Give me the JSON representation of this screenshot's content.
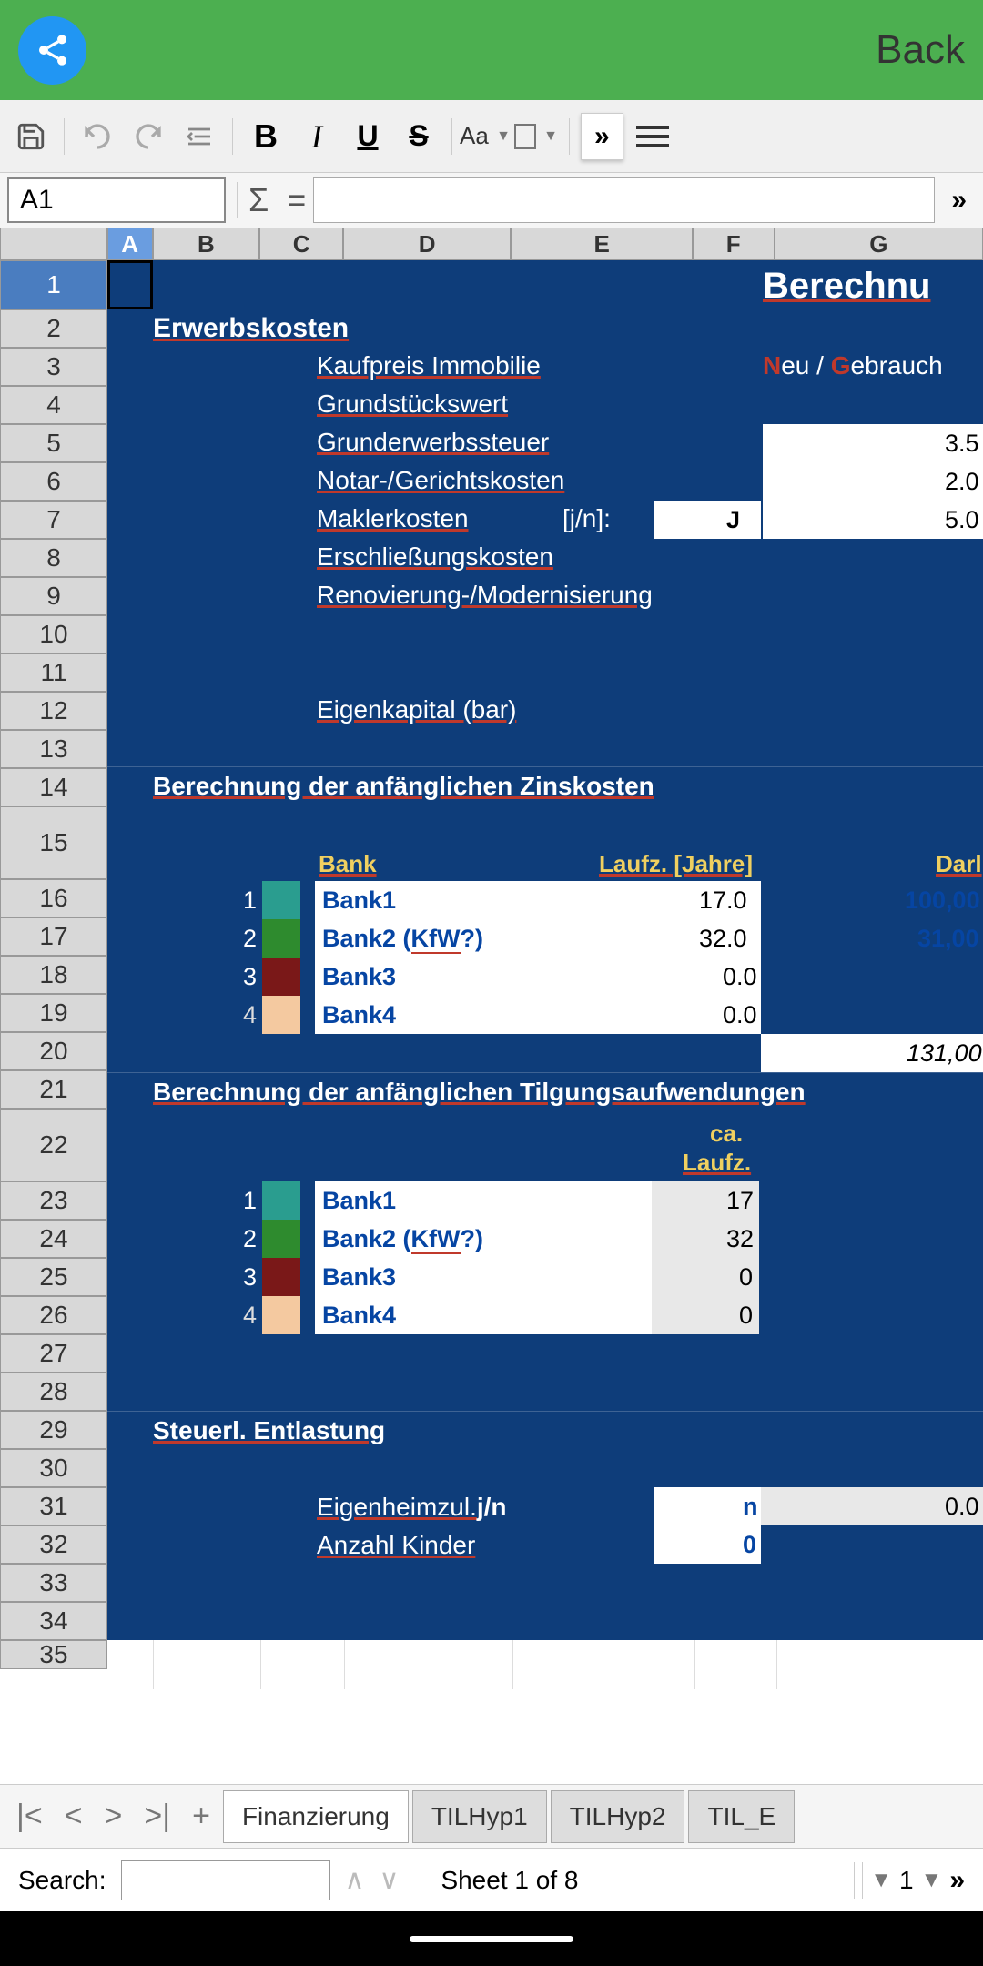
{
  "header": {
    "back": "Back"
  },
  "formula": {
    "cell_ref": "A1"
  },
  "columns": [
    "A",
    "B",
    "C",
    "D",
    "E",
    "F",
    "G"
  ],
  "rows": [
    1,
    2,
    3,
    4,
    5,
    6,
    7,
    8,
    9,
    10,
    11,
    12,
    13,
    14,
    15,
    16,
    17,
    18,
    19,
    20,
    21,
    22,
    23,
    24,
    25,
    26,
    27,
    28,
    29,
    30,
    31,
    32,
    33,
    34,
    35
  ],
  "content": {
    "title": "Berechnu",
    "sec_erwerb": "Erwerbskosten",
    "kaufpreis": "Kaufpreis Immobilie",
    "neu_gebraucht_n": "N",
    "neu_gebraucht_mid": "eu / ",
    "neu_gebraucht_g": "G",
    "neu_gebraucht_end": "ebrauch",
    "grundst": "Grundstückswert",
    "grunderwerb": "Grunderwerbssteuer",
    "v3_50": "3.5",
    "notar": "Notar-/Gerichtskosten",
    "v2_00": "2.0",
    "makler": "Maklerkosten",
    "jn": "[j/n]:",
    "j": "J",
    "v5_00": "5.0",
    "erschl": "Erschließungskosten",
    "renov": "Renovierung-/Modernisierung",
    "eigen": "Eigenkapital (bar)",
    "sec_zins": "Berechnung der anfänglichen Zinskosten",
    "h_bank": "Bank",
    "h_laufz": "Laufz. [Jahre]",
    "h_darl": "Darl",
    "banks": [
      {
        "n": "1",
        "name": "Bank1",
        "laufz": "17.0",
        "darl": "100,00",
        "ca": "17",
        "color": "#2a9d8f"
      },
      {
        "n": "2",
        "name": "Bank2 (KfW?)",
        "laufz": "32.0",
        "darl": "31,00",
        "ca": "32",
        "color": "#2e8b2e"
      },
      {
        "n": "3",
        "name": "Bank3",
        "laufz": "0.0",
        "darl": "",
        "ca": "0",
        "color": "#7a1818"
      },
      {
        "n": "4",
        "name": "Bank4",
        "laufz": "0.0",
        "darl": "",
        "ca": "0",
        "color": "#f4c9a0"
      }
    ],
    "sum_darl": "131,00",
    "sec_tilg": "Berechnung der anfänglichen Tilgungsaufwendungen",
    "ca_laufz_1": "ca.",
    "ca_laufz_2": "Laufz.",
    "sec_steuer": "Steuerl. Entlastung",
    "eigenheim": "Eigenheimzul.",
    "eigenheim_jn": "j/n",
    "eig_val": "n",
    "eig_amt": "0.0",
    "anzahl_kinder": "Anzahl Kinder",
    "kinder_val": "0"
  },
  "tabs": {
    "active": "Finanzierung",
    "list": [
      "TILHyp1",
      "TILHyp2",
      "TIL_E"
    ]
  },
  "search": {
    "label": "Search:",
    "sheet_info": "Sheet 1 of 8",
    "page": "1"
  }
}
